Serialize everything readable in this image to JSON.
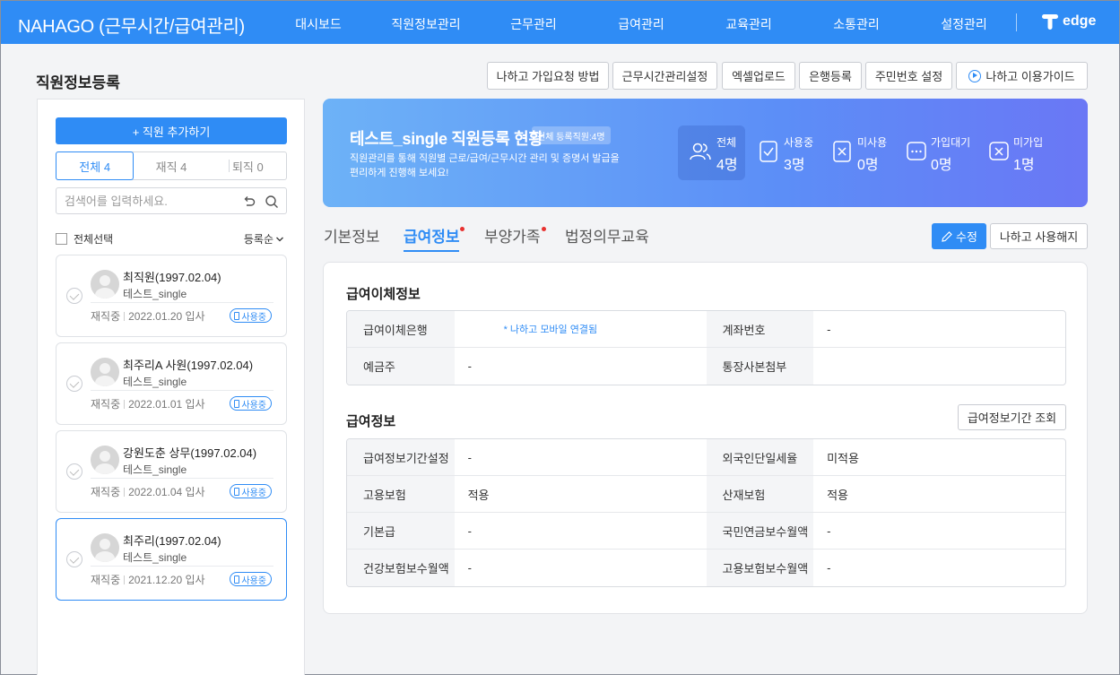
{
  "app": {
    "brand": "NAHAGO (근무시간/급여관리)",
    "nav": [
      "대시보드",
      "직원정보관리",
      "근무관리",
      "급여관리",
      "교육관리",
      "소통관리",
      "설정관리"
    ],
    "logo_text": "edge"
  },
  "page": {
    "title": "직원정보등록"
  },
  "top_buttons": [
    "나하고 가입요청 방법",
    "근무시간관리설정",
    "엑셀업로드",
    "은행등록",
    "주민번호 설정",
    "나하고 이용가이드"
  ],
  "left": {
    "add_button": "+ 직원 추가하기",
    "filters": [
      "전체 4",
      "재직 4",
      "퇴직 0"
    ],
    "active_filter": "전체 4",
    "search_placeholder": "검색어를 입력하세요.",
    "select_all": "전체선택",
    "sort": "등록순",
    "employees": [
      {
        "name": "최직원(1997.02.04)",
        "company": "테스트_single",
        "state": "재직중",
        "date": "2022.01.20 입사",
        "status": "사용중",
        "selected": false
      },
      {
        "name": "최주리A 사원(1997.02.04)",
        "company": "테스트_single",
        "state": "재직중",
        "date": "2022.01.01 입사",
        "status": "사용중",
        "selected": false
      },
      {
        "name": "강원도춘 상무(1997.02.04)",
        "company": "테스트_single",
        "state": "재직중",
        "date": "2022.01.04 입사",
        "status": "사용중",
        "selected": false
      },
      {
        "name": "최주리(1997.02.04)",
        "company": "테스트_single",
        "state": "재직중",
        "date": "2021.12.20 입사",
        "status": "사용중",
        "selected": true
      }
    ]
  },
  "banner": {
    "title": "테스트_single 직원등록 현황",
    "badge": "전체 등록직원:4명",
    "desc": "직원관리를 통해 직원별 근로/급여/근무시간 관리 및 증명서 발급을 편리하게 진행해 보세요!",
    "stats": [
      {
        "label": "전체",
        "value": "4명"
      },
      {
        "label": "사용중",
        "value": "3명"
      },
      {
        "label": "미사용",
        "value": "0명"
      },
      {
        "label": "가입대기",
        "value": "0명"
      },
      {
        "label": "미가입",
        "value": "1명"
      }
    ]
  },
  "tabs": [
    "기본정보",
    "급여정보",
    "부양가족",
    "법정의무교육"
  ],
  "active_tab": "급여정보",
  "actions": {
    "edit": "수정",
    "cancel": "나하고 사용해지"
  },
  "transfer": {
    "title": "급여이체정보",
    "rows": [
      [
        {
          "label": "급여이체은행",
          "value": "* 나하고 모바일 연결됨"
        },
        {
          "label": "계좌번호",
          "value": "-"
        }
      ],
      [
        {
          "label": "예금주",
          "value": "-"
        },
        {
          "label": "통장사본첨부",
          "value": ""
        }
      ]
    ]
  },
  "salary": {
    "title": "급여정보",
    "period_button": "급여정보기간 조회",
    "rows": [
      [
        {
          "label": "급여정보기간설정",
          "value": "-"
        },
        {
          "label": "외국인단일세율",
          "value": "미적용"
        }
      ],
      [
        {
          "label": "고용보험",
          "value": "적용"
        },
        {
          "label": "산재보험",
          "value": "적용"
        }
      ],
      [
        {
          "label": "기본급",
          "value": "-"
        },
        {
          "label": "국민연금보수월액",
          "value": "-"
        }
      ],
      [
        {
          "label": "건강보험보수월액",
          "value": "-"
        },
        {
          "label": "고용보험보수월액",
          "value": "-"
        }
      ]
    ]
  }
}
